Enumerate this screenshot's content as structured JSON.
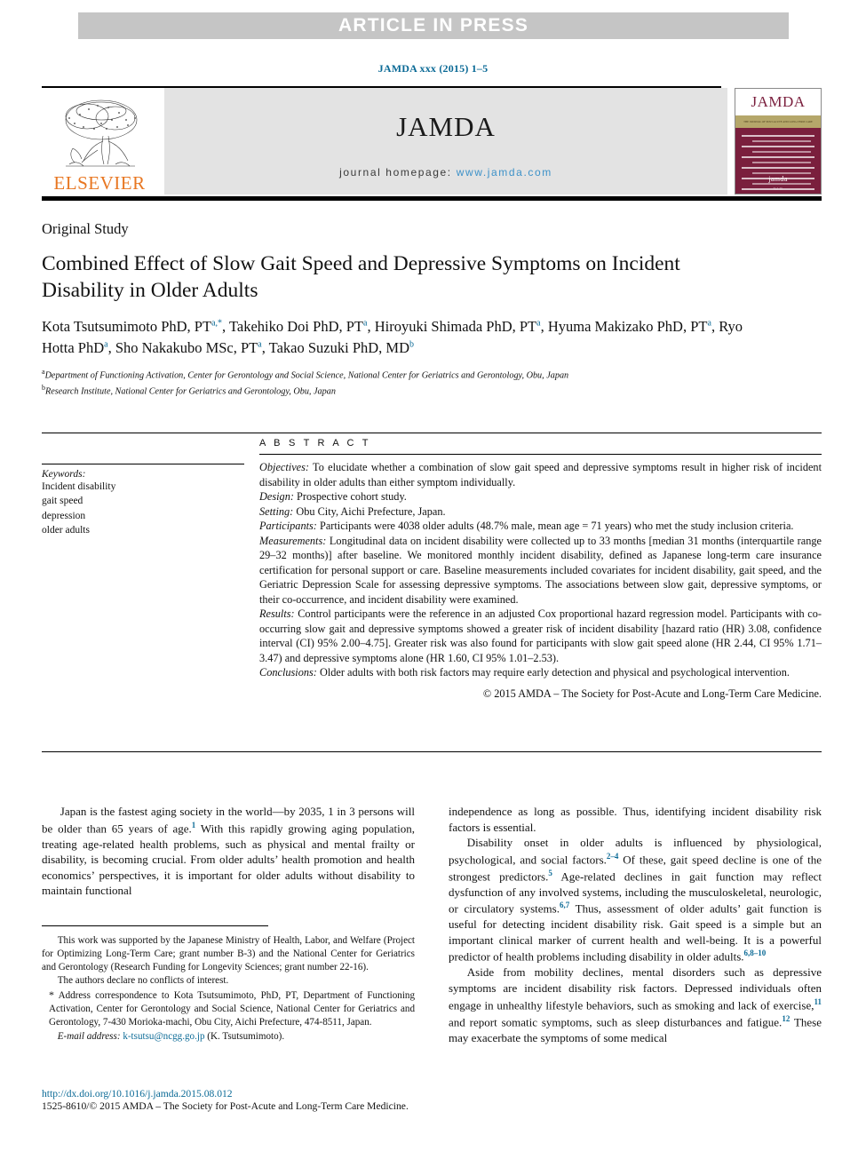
{
  "banner": {
    "text": "ARTICLE IN PRESS"
  },
  "journal_ref": "JAMDA xxx (2015) 1–5",
  "masthead": {
    "publisher": "ELSEVIER",
    "wordmark": "JAMDA",
    "homepage_label": "journal homepage:",
    "homepage_url": "www.jamda.com",
    "cover": {
      "title": "JAMDA",
      "subtitle": "THE JOURNAL OF POST-ACUTE AND LONG-TERM CARE MEDICINE",
      "logo": "jamda",
      "volume": "Vol 16"
    }
  },
  "article": {
    "section_label": "Original Study",
    "title": "Combined Effect of Slow Gait Speed and Depressive Symptoms on Incident Disability in Older Adults",
    "authors": [
      {
        "name": "Kota Tsutsumimoto PhD, PT",
        "marks": "a,*",
        "sep": ", "
      },
      {
        "name": "Takehiko Doi PhD, PT",
        "marks": "a",
        "sep": ", "
      },
      {
        "name": "Hiroyuki Shimada PhD, PT",
        "marks": "a",
        "sep": ", "
      },
      {
        "name": "Hyuma Makizako PhD, PT",
        "marks": "a",
        "sep": ", "
      },
      {
        "name": "Ryo Hotta PhD",
        "marks": "a",
        "sep": ", "
      },
      {
        "name": "Sho Nakakubo MSc, PT",
        "marks": "a",
        "sep": ", "
      },
      {
        "name": "Takao Suzuki PhD, MD",
        "marks": "b",
        "sep": ""
      }
    ],
    "affiliations": [
      {
        "mark": "a",
        "text": "Department of Functioning Activation, Center for Gerontology and Social Science, National Center for Geriatrics and Gerontology, Obu, Japan"
      },
      {
        "mark": "b",
        "text": "Research Institute, National Center for Geriatrics and Gerontology, Obu, Japan"
      }
    ]
  },
  "keywords": {
    "heading": "Keywords:",
    "items": [
      "Incident disability",
      "gait speed",
      "depression",
      "older adults"
    ]
  },
  "abstract": {
    "heading": "A B S T R A C T",
    "sections": [
      {
        "label": "Objectives:",
        "text": " To elucidate whether a combination of slow gait speed and depressive symptoms result in higher risk of incident disability in older adults than either symptom individually."
      },
      {
        "label": "Design:",
        "text": " Prospective cohort study."
      },
      {
        "label": "Setting:",
        "text": " Obu City, Aichi Prefecture, Japan."
      },
      {
        "label": "Participants:",
        "text": " Participants were 4038 older adults (48.7% male, mean age = 71 years) who met the study inclusion criteria."
      },
      {
        "label": "Measurements:",
        "text": " Longitudinal data on incident disability were collected up to 33 months [median 31 months (interquartile range 29–32 months)] after baseline. We monitored monthly incident disability, defined as Japanese long-term care insurance certification for personal support or care. Baseline measurements included covariates for incident disability, gait speed, and the Geriatric Depression Scale for assessing depressive symptoms. The associations between slow gait, depressive symptoms, or their co-occurrence, and incident disability were examined."
      },
      {
        "label": "Results:",
        "text": " Control participants were the reference in an adjusted Cox proportional hazard regression model. Participants with co-occurring slow gait and depressive symptoms showed a greater risk of incident disability [hazard ratio (HR) 3.08, confidence interval (CI) 95% 2.00–4.75]. Greater risk was also found for participants with slow gait speed alone (HR 2.44, CI 95% 1.71–3.47) and depressive symptoms alone (HR 1.60, CI 95% 1.01–2.53)."
      },
      {
        "label": "Conclusions:",
        "text": " Older adults with both risk factors may require early detection and physical and psychological intervention."
      }
    ],
    "copyright": "© 2015 AMDA – The Society for Post-Acute and Long-Term Care Medicine."
  },
  "body": {
    "left": [
      {
        "pre": "Japan is the fastest aging society in the world—by 2035, 1 in 3 persons will be older than 65 years of age.",
        "ref": "1",
        "post": " With this rapidly growing aging population, treating age-related health problems, such as physical and mental frailty or disability, is becoming crucial. From older adults’ health promotion and health economics’ perspectives, it is important for older adults without disability to maintain functional"
      }
    ],
    "right": [
      {
        "pre": "independence as long as possible. Thus, identifying incident disability risk factors is essential.",
        "ref": "",
        "post": "",
        "indent": false
      },
      {
        "pre": "Disability onset in older adults is influenced by physiological, psychological, and social factors.",
        "ref": "2–4",
        "post": " Of these, gait speed decline is one of the strongest predictors.",
        "ref2": "5",
        "post2": " Age-related declines in gait function may reflect dysfunction of any involved systems, including the musculoskeletal, neurologic, or circulatory systems.",
        "ref3": "6,7",
        "post3": " Thus, assessment of older adults’ gait function is useful for detecting incident disability risk. Gait speed is a simple but an important clinical marker of current health and well-being. It is a powerful predictor of health problems including disability in older adults.",
        "ref4": "6,8–10",
        "post4": "",
        "indent": true
      },
      {
        "pre": "Aside from mobility declines, mental disorders such as depressive symptoms are incident disability risk factors. Depressed individuals often engage in unhealthy lifestyle behaviors, such as smoking and lack of exercise,",
        "ref": "11",
        "post": " and report somatic symptoms, such as sleep disturbances and fatigue.",
        "ref2": "12",
        "post2": " These may exacerbate the symptoms of some medical",
        "indent": true
      }
    ]
  },
  "footnotes": {
    "funding": "This work was supported by the Japanese Ministry of Health, Labor, and Welfare (Project for Optimizing Long-Term Care; grant number B-3) and the National Center for Geriatrics and Gerontology (Research Funding for Longevity Sciences; grant number 22-16).",
    "conflicts": "The authors declare no conflicts of interest.",
    "correspondence_mark": "*",
    "correspondence": " Address correspondence to Kota Tsutsumimoto, PhD, PT, Department of Functioning Activation, Center for Gerontology and Social Science, National Center for Geriatrics and Gerontology, 7-430 Morioka-machi, Obu City, Aichi Prefecture, 474-8511, Japan.",
    "email_label": "E-mail address:",
    "email": "k-tsutsu@ncgg.go.jp",
    "email_suffix": " (K. Tsutsumimoto)."
  },
  "doi": {
    "url": "http://dx.doi.org/10.1016/j.jamda.2015.08.012",
    "issn_line": "1525-8610/© 2015 AMDA – The Society for Post-Acute and Long-Term Care Medicine."
  },
  "colors": {
    "banner_bg": "#c5c5c5",
    "link": "#0b6a96",
    "elsevier_orange": "#e87722",
    "homepage_bg": "#e3e3e3",
    "cover_maroon": "#7a1f3d"
  }
}
